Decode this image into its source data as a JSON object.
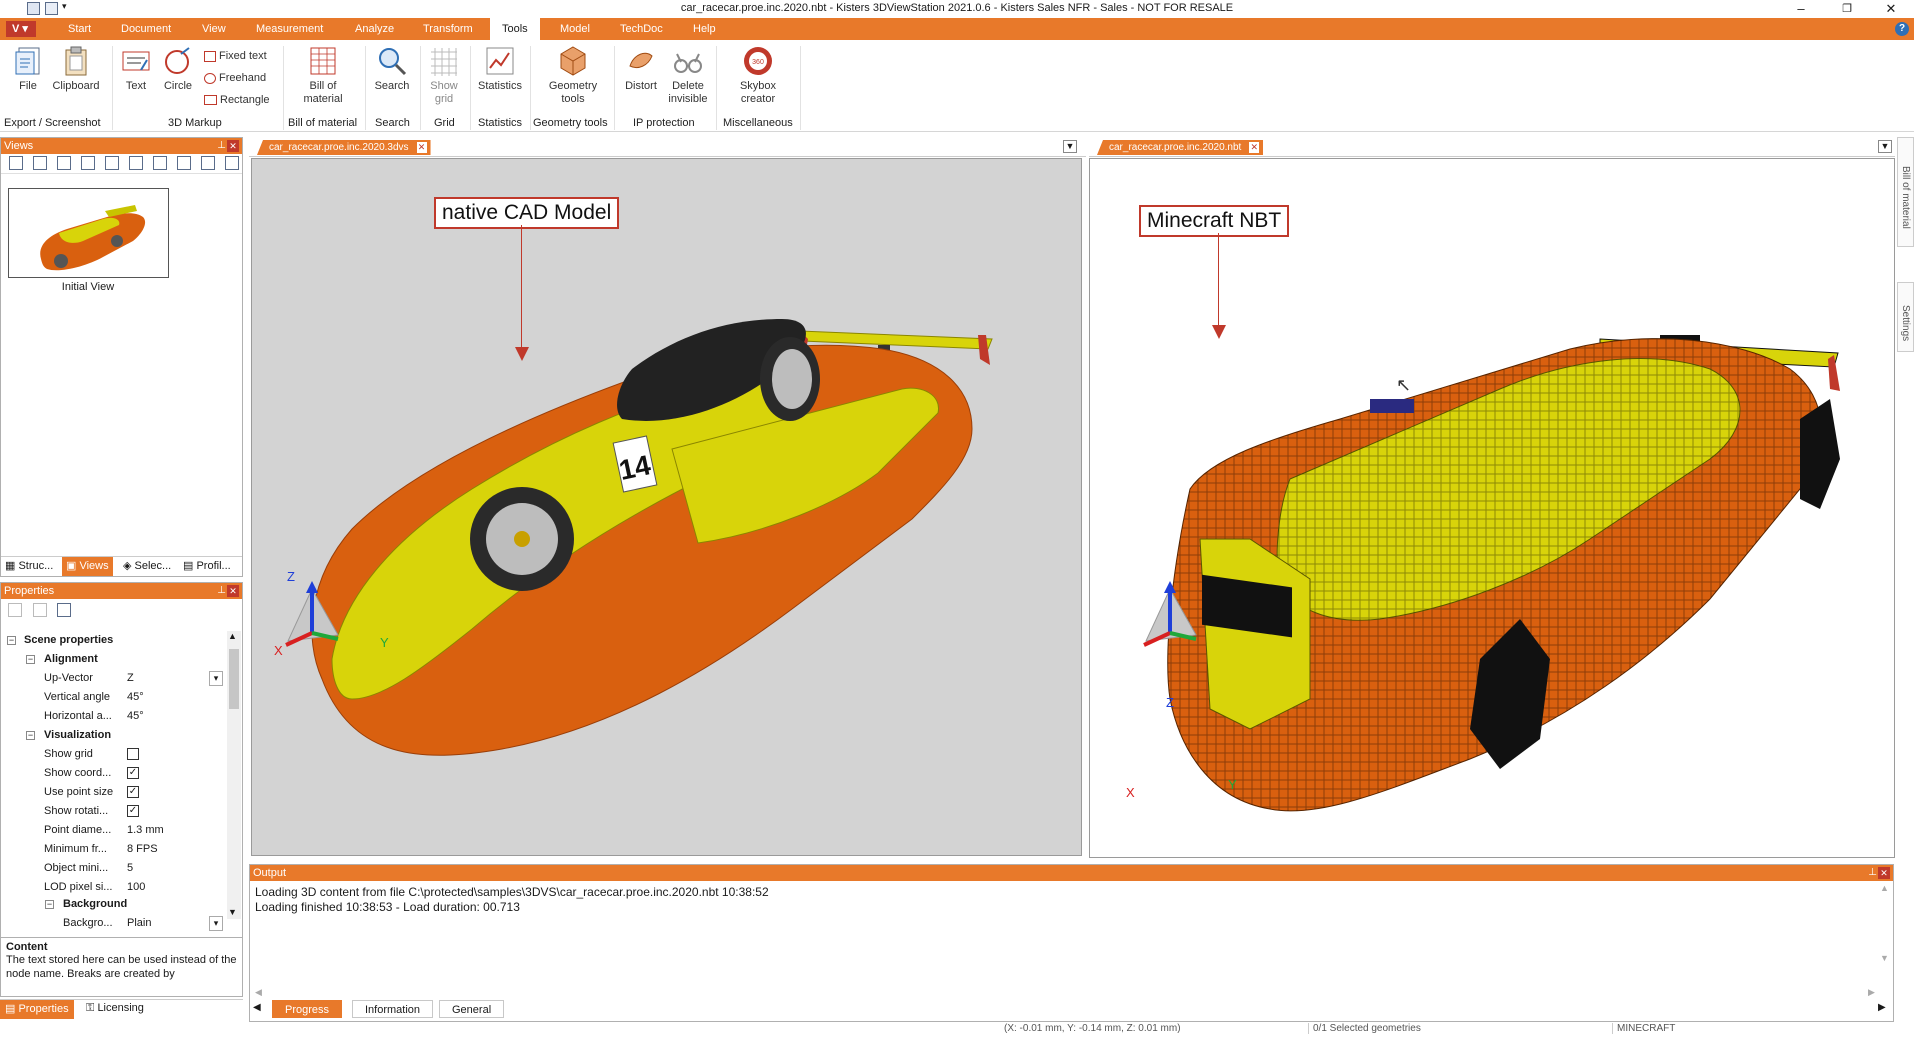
{
  "window": {
    "title": "car_racecar.proe.inc.2020.nbt - Kisters 3DViewStation 2021.0.6 - Kisters Sales NFR - Sales - NOT FOR RESALE"
  },
  "quick_access": {
    "app_menu": "V"
  },
  "menu": [
    "Start",
    "Document",
    "View",
    "Measurement",
    "Analyze",
    "Transform",
    "Tools",
    "Model",
    "TechDoc",
    "Help"
  ],
  "ribbon": {
    "file": "File",
    "clipboard": "Clipboard",
    "text": "Text",
    "circle": "Circle",
    "fixed_text": "Fixed text",
    "freehand": "Freehand",
    "rectangle": "Rectangle",
    "bom": [
      "Bill of",
      "material"
    ],
    "search": "Search",
    "show_grid": [
      "Show",
      "grid"
    ],
    "statistics": "Statistics",
    "geometry_tools": [
      "Geometry",
      "tools"
    ],
    "distort": "Distort",
    "delete_invisible": [
      "Delete",
      "invisible"
    ],
    "skybox": [
      "Skybox",
      "creator"
    ],
    "groups": [
      "Export / Screenshot",
      "3D Markup",
      "Bill of material",
      "Search",
      "Grid",
      "Statistics",
      "Geometry tools",
      "IP protection",
      "Miscellaneous"
    ]
  },
  "views_panel": {
    "title": "Views",
    "thumb_label": "Initial View",
    "tabs": [
      "Struc...",
      "Views",
      "Selec...",
      "Profil..."
    ]
  },
  "props_panel": {
    "title": "Properties",
    "scene": "Scene properties",
    "alignment": "Alignment",
    "visualization": "Visualization",
    "background": "Background",
    "rows": {
      "up_vector": {
        "k": "Up-Vector",
        "v": "Z"
      },
      "vertical_angle": {
        "k": "Vertical angle",
        "v": "45°"
      },
      "horizontal_angle": {
        "k": "Horizontal a...",
        "v": "45°"
      },
      "show_grid": {
        "k": "Show grid",
        "v": ""
      },
      "show_coord": {
        "k": "Show coord...",
        "v": "✓"
      },
      "use_point_size": {
        "k": "Use point size",
        "v": "✓"
      },
      "show_rotation": {
        "k": "Show rotati...",
        "v": "✓"
      },
      "point_diameter": {
        "k": "Point diame...",
        "v": "1.3 mm"
      },
      "min_fps": {
        "k": "Minimum fr...",
        "v": "8 FPS"
      },
      "object_min": {
        "k": "Object mini...",
        "v": "5"
      },
      "lod_pixel": {
        "k": "LOD pixel si...",
        "v": "100"
      },
      "background": {
        "k": "Backgro...",
        "v": "Plain"
      }
    },
    "content_title": "Content",
    "content_text": "The text stored here can be used instead of the node name. Breaks are created by",
    "bottom_tabs": [
      "Properties",
      "Licensing"
    ]
  },
  "viewport_left": {
    "tab": "car_racecar.proe.inc.2020.3dvs",
    "callout": "native CAD Model",
    "race_number": "14"
  },
  "viewport_right": {
    "tab": "car_racecar.proe.inc.2020.nbt",
    "callout": "Minecraft NBT"
  },
  "side_tabs": [
    "Bill of material",
    "Settings"
  ],
  "axes": {
    "x": "X",
    "y": "Y",
    "z": "Z"
  },
  "output": {
    "title": "Output",
    "lines": [
      "Loading 3D content from file C:\\protected\\samples\\3DVS\\car_racecar.proe.inc.2020.nbt 10:38:52",
      "Loading finished 10:38:53 - Load duration: 00.713"
    ],
    "tabs": [
      "Progress",
      "Information",
      "General"
    ]
  },
  "status": {
    "coords": "(X: -0.01 mm, Y: -0.14 mm, Z: 0.01 mm)",
    "selection": "0/1 Selected geometries",
    "mode": "MINECRAFT"
  },
  "colors": {
    "accent": "#e8792a",
    "car_orange": "#d9600f",
    "car_yellow": "#d8d40a"
  }
}
